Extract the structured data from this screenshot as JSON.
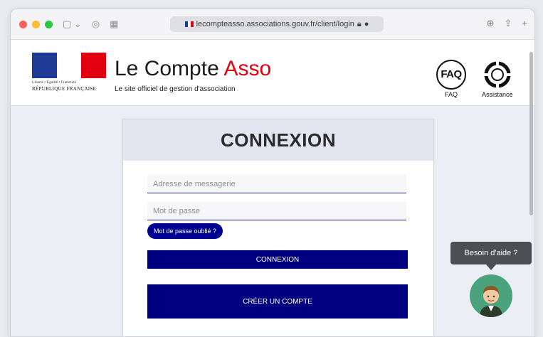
{
  "browser": {
    "url": "lecompteasso.associations.gouv.fr/client/login"
  },
  "header": {
    "motto": "Liberté • Égalité • Fraternité",
    "republic": "RÉPUBLIQUE FRANÇAISE",
    "title_part1": "Le Compte ",
    "title_part2": "Asso",
    "subtitle": "Le site officiel de gestion d'association",
    "faq_icon_text": "FAQ",
    "faq_label": "FAQ",
    "assistance_label": "Assistance"
  },
  "login": {
    "heading": "CONNEXION",
    "email_placeholder": "Adresse de messagerie",
    "password_placeholder": "Mot de passe",
    "forgot_label": "Mot de passe oublié ?",
    "login_button": "CONNEXION",
    "create_button": "CRÉER UN COMPTE"
  },
  "help": {
    "bubble": "Besoin d'aide ?"
  },
  "colors": {
    "primary": "#000080",
    "accent_red": "#e1000f",
    "flag_blue": "#1f3a94",
    "help_green": "#4aa37c"
  }
}
